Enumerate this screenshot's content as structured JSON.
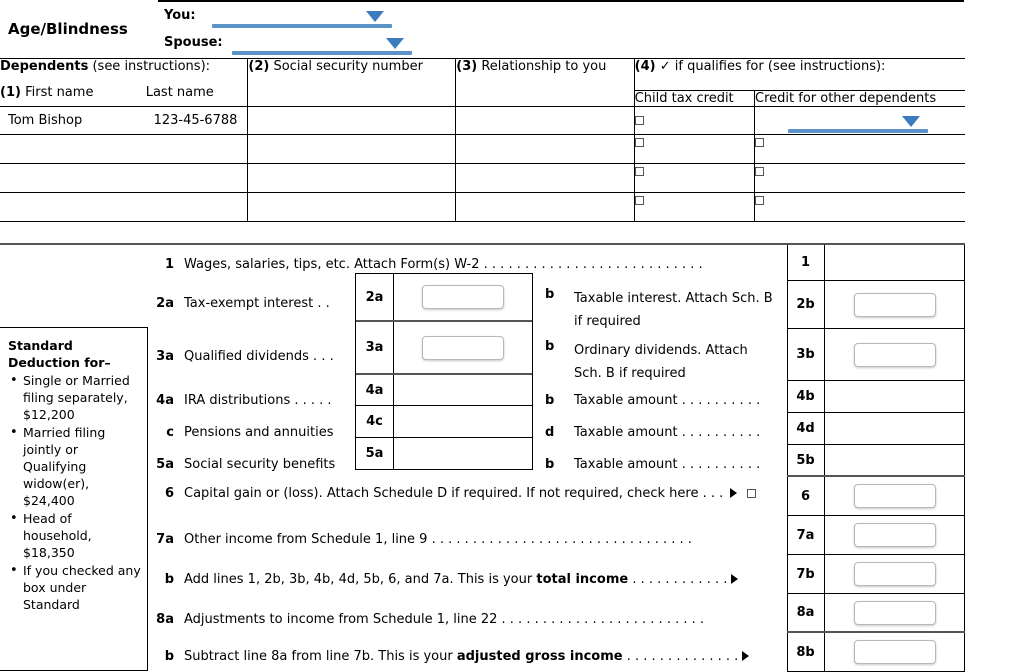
{
  "age_blindness": {
    "section_label": "Age/Blindness",
    "rows": [
      {
        "label": "You:",
        "control": "dropdown"
      },
      {
        "label": "Spouse:",
        "control": "dropdown"
      }
    ]
  },
  "dependents": {
    "col1_title": "Dependents",
    "col1_note": "(see instructions):",
    "col1_sub_num": "(1)",
    "col1_sub_first": "First name",
    "col1_sub_last": "Last name",
    "col2": "(2) Social security number",
    "col3": "(3) Relationship to you",
    "col4": "(4) ✓ if qualifies for (see instructions):",
    "col4a": "Child tax credit",
    "col4b": "Credit for other dependents",
    "rows": [
      {
        "first_last": "Tom Bishop",
        "ssn": "123-45-6788",
        "relationship": "",
        "child_tax_credit": "checkbox",
        "other_dependents": "dropdown"
      },
      {
        "first_last": "",
        "ssn": "",
        "relationship": "",
        "child_tax_credit": "checkbox",
        "other_dependents": "checkbox"
      },
      {
        "first_last": "",
        "ssn": "",
        "relationship": "",
        "child_tax_credit": "checkbox",
        "other_dependents": "checkbox"
      },
      {
        "first_last": "",
        "ssn": "",
        "relationship": "",
        "child_tax_credit": "checkbox",
        "other_dependents": "checkbox"
      }
    ]
  },
  "standard_deduction": {
    "title_line1": "Standard",
    "title_line2": "Deduction for–",
    "bullets": [
      "Single or Married filing separately, $12,200",
      "Married filing jointly or Qualifying widow(er), $24,400",
      "Head of household, $18,350",
      "If you checked any box under Standard"
    ]
  },
  "income": {
    "line1": {
      "num": "1",
      "text": "Wages, salaries, tips, etc. Attach Form(s) W-2 . . . . . . . . . . . . . . . . . . . . . . . . . . .",
      "stub_num": "1"
    },
    "line2a": {
      "num": "2a",
      "text": "Tax-exempt interest . .",
      "box_num": "2a"
    },
    "line2b": {
      "num": "b",
      "text1": "Taxable interest. Attach Sch. B",
      "text2": "if required",
      "stub_num": "2b"
    },
    "line3a": {
      "num": "3a",
      "text": "Qualified dividends . . .",
      "box_num": "3a"
    },
    "line3b": {
      "num": "b",
      "text1": "Ordinary dividends. Attach",
      "text2": "Sch. B if required",
      "stub_num": "3b"
    },
    "line4a": {
      "num": "4a",
      "text": "IRA distributions . . . . .",
      "box_num": "4a"
    },
    "line4b": {
      "num": "b",
      "text": "Taxable amount . . . . . . . . . .",
      "stub_num": "4b"
    },
    "line4c": {
      "num": "c",
      "text": "Pensions and annuities",
      "box_num": "4c"
    },
    "line4d": {
      "num": "d",
      "text": "Taxable amount . . . . . . . . . .",
      "stub_num": "4d"
    },
    "line5a": {
      "num": "5a",
      "text": "Social security benefits",
      "box_num": "5a"
    },
    "line5b": {
      "num": "b",
      "text": "Taxable amount . . . . . . . . . .",
      "stub_num": "5b"
    },
    "line6": {
      "num": "6",
      "text": "Capital gain or (loss). Attach Schedule D if required. If not required, check here . . .",
      "stub_num": "6"
    },
    "line7a": {
      "num": "7a",
      "text": "Other income from Schedule 1, line 9 . . . . . . . . . . . . . . . . . . . . . . . . . . . . . . . .",
      "stub_num": "7a"
    },
    "line7b": {
      "num": "b",
      "text_pre": "Add lines 1, 2b, 3b, 4b, 4d, 5b, 6, and 7a. This is your ",
      "text_bold": "total income",
      "text_post": " . . . . . . . . . . . .",
      "stub_num": "7b"
    },
    "line8a": {
      "num": "8a",
      "text": "Adjustments to income from Schedule 1, line 22 . . . . . . . . . . . . . . . . . . . . . . . . .",
      "stub_num": "8a"
    },
    "line8b": {
      "num": "b",
      "text_pre": "Subtract line 8a from line 7b. This is your ",
      "text_bold": "adjusted gross income",
      "text_post": " . . . . . . . . . . . . . .",
      "stub_num": "8b"
    }
  },
  "colors": {
    "dropdown_blue": "#5b92c8",
    "dropdown_tri": "#3a7cbd",
    "rule": "#000000"
  }
}
